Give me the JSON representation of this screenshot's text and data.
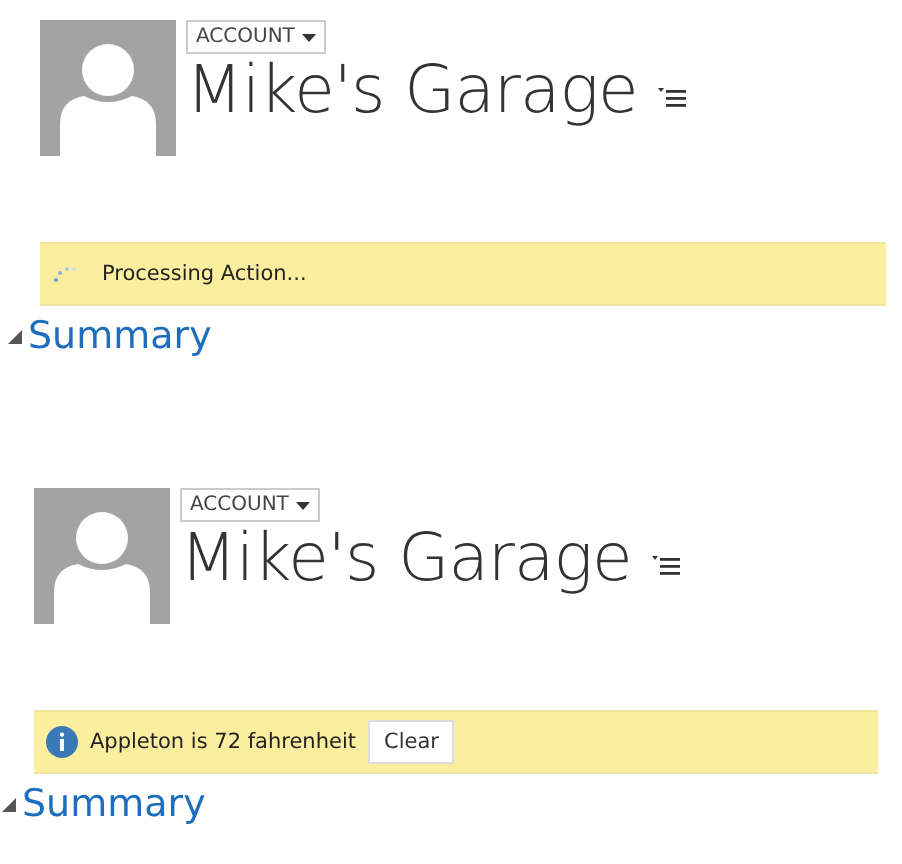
{
  "panels": [
    {
      "entity_type": "ACCOUNT",
      "title": "Mike's Garage",
      "notification": {
        "kind": "loading",
        "text": "Processing Action..."
      },
      "section": {
        "label": "Summary",
        "expanded": true
      }
    },
    {
      "entity_type": "ACCOUNT",
      "title": "Mike's Garage",
      "notification": {
        "kind": "info",
        "text": "Appleton is 72 fahrenheit",
        "button": "Clear"
      },
      "section": {
        "label": "Summary",
        "expanded": true
      }
    }
  ]
}
